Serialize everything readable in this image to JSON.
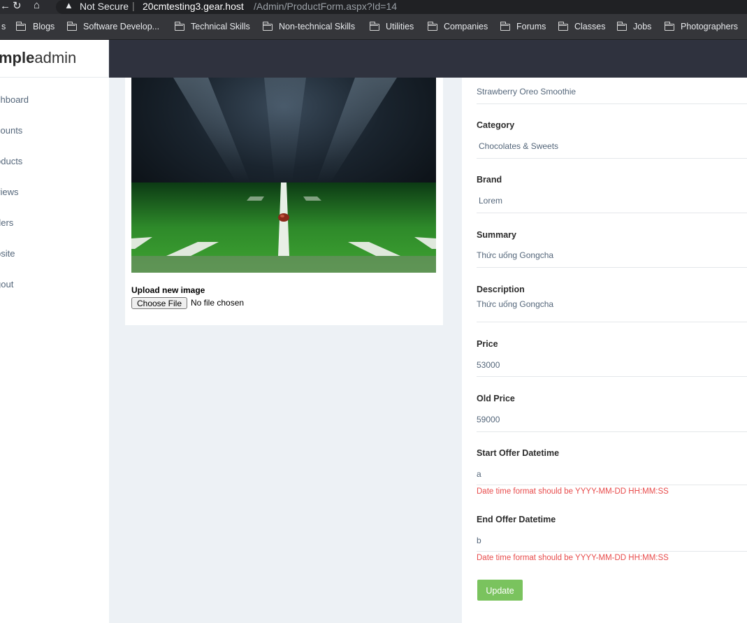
{
  "browser": {
    "security_label": "Not Secure",
    "url_host": "20cmtesting3.gear.host",
    "url_path": "/Admin/ProductForm.aspx?Id=14",
    "bookmarks": [
      "s",
      "Blogs",
      "Software Develop...",
      "Technical Skills",
      "Non-technical Skills",
      "Utilities",
      "Companies",
      "Forums",
      "Classes",
      "Jobs",
      "Photographers"
    ]
  },
  "logo": {
    "bold": "mple",
    "light": "admin"
  },
  "sidebar": {
    "items": [
      "shboard",
      "counts",
      "oducts",
      "views",
      "ders",
      "bsite",
      "gout"
    ]
  },
  "image_section": {
    "upload_label": "Upload new image",
    "choose_file": "Choose File",
    "no_file": "No file chosen"
  },
  "form": {
    "name_value": "Strawberry Oreo Smoothie",
    "category_label": "Category",
    "category_value": "Chocolates & Sweets",
    "brand_label": "Brand",
    "brand_value": "Lorem",
    "summary_label": "Summary",
    "summary_value": "Thức uống Gongcha",
    "description_label": "Description",
    "description_value": "Thức uống Gongcha",
    "price_label": "Price",
    "price_value": "53000",
    "old_price_label": "Old Price",
    "old_price_value": "59000",
    "start_label": "Start Offer Datetime",
    "start_value": "a",
    "start_error": "Date time format should be YYYY-MM-DD HH:MM:SS",
    "end_label": "End Offer Datetime",
    "end_value": "b",
    "end_error": "Date time format should be YYYY-MM-DD HH:MM:SS",
    "update_label": "Update"
  },
  "colors": {
    "accent_green": "#7ac35e",
    "error_red": "#e84c4c",
    "topbar": "#2f323e"
  }
}
